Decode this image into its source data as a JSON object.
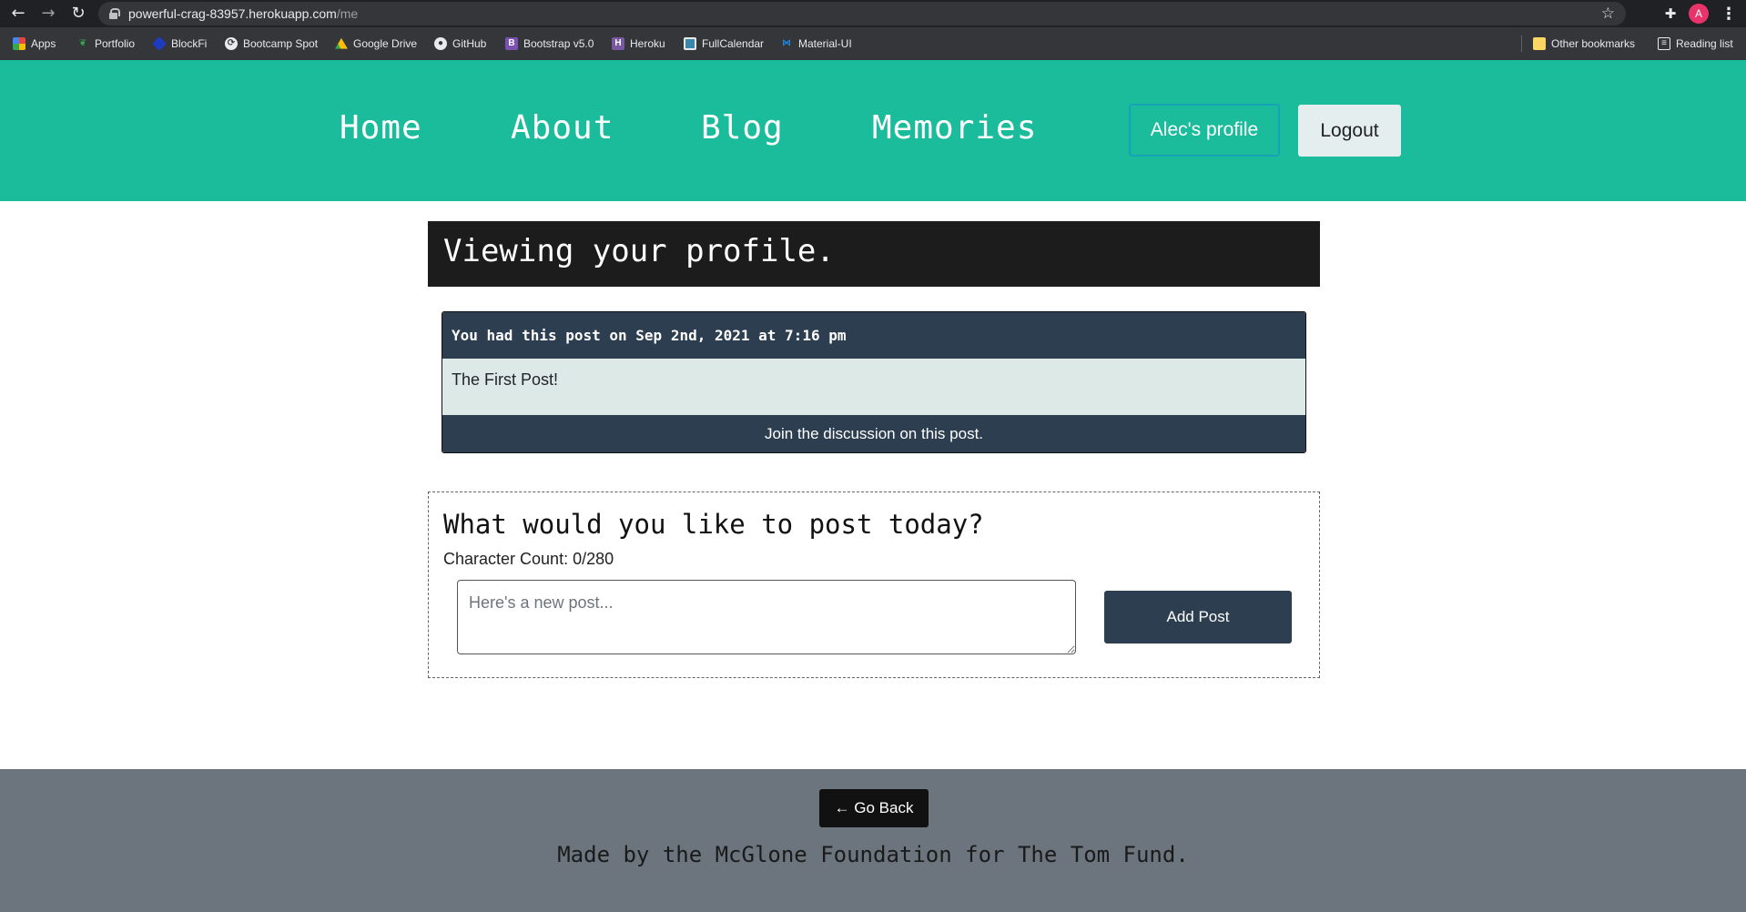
{
  "browser": {
    "url_host": "powerful-crag-83957.herokuapp.com",
    "url_path": "/me",
    "profile_initial": "A",
    "bookmarks": [
      {
        "label": "Apps",
        "icon": "apps-grid-icon",
        "color": "#e8453c"
      },
      {
        "label": "Portfolio",
        "icon": "portfolio-leaf-icon",
        "color": "#34a853"
      },
      {
        "label": "BlockFi",
        "icon": "blockfi-icon",
        "color": "#1d3bbf"
      },
      {
        "label": "Bootcamp Spot",
        "icon": "bootcamp-spot-icon",
        "color": "#e8eaed"
      },
      {
        "label": "Google Drive",
        "icon": "google-drive-icon",
        "color": "#fbbc04"
      },
      {
        "label": "GitHub",
        "icon": "github-icon",
        "color": "#e8eaed"
      },
      {
        "label": "Bootstrap v5.0",
        "icon": "bootstrap-icon",
        "color": "#7952b3"
      },
      {
        "label": "Heroku",
        "icon": "heroku-icon",
        "color": "#79589f"
      },
      {
        "label": "FullCalendar",
        "icon": "fullcalendar-icon",
        "color": "#3a87ad"
      },
      {
        "label": "Material-UI",
        "icon": "material-ui-icon",
        "color": "#1e88e5"
      }
    ],
    "other_bookmarks": "Other bookmarks",
    "reading_list": "Reading list"
  },
  "header": {
    "nav": [
      "Home",
      "About",
      "Blog",
      "Memories"
    ],
    "profile_button": "Alec's profile",
    "logout_button": "Logout",
    "background": "#1abc9c"
  },
  "main": {
    "banner_title": "Viewing your profile.",
    "posts": [
      {
        "meta": "You had this post on Sep 2nd, 2021 at 7:16 pm",
        "body": "The First Post!",
        "discussion_link": "Join the discussion on this post."
      }
    ],
    "compose": {
      "title": "What would you like to post today?",
      "char_count": "Character Count: 0/280",
      "placeholder": "Here's a new post...",
      "submit": "Add Post"
    }
  },
  "footer": {
    "back_button": "← Go Back",
    "credit": "Made by the McGlone Foundation for The Tom Fund."
  }
}
